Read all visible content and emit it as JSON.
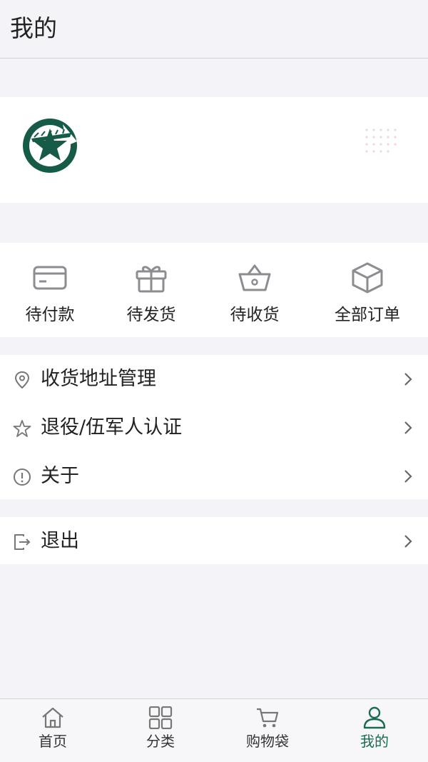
{
  "header": {
    "title": "我的"
  },
  "profile": {
    "avatar_icon": "star-emblem-icon",
    "brand_color": "#155b47"
  },
  "orders": [
    {
      "label": "待付款",
      "icon": "card-icon"
    },
    {
      "label": "待发货",
      "icon": "gift-icon"
    },
    {
      "label": "待收货",
      "icon": "basket-icon"
    },
    {
      "label": "全部订单",
      "icon": "box-icon"
    }
  ],
  "menu": [
    {
      "label": "收货地址管理",
      "icon": "location-pin-icon"
    },
    {
      "label": "退役/伍军人认证",
      "icon": "star-outline-icon"
    },
    {
      "label": "关于",
      "icon": "info-circle-icon"
    }
  ],
  "logout": {
    "label": "退出",
    "icon": "logout-icon"
  },
  "tabbar": {
    "items": [
      {
        "label": "首页",
        "icon": "home-icon"
      },
      {
        "label": "分类",
        "icon": "grid-icon"
      },
      {
        "label": "购物袋",
        "icon": "cart-icon"
      },
      {
        "label": "我的",
        "icon": "user-icon"
      }
    ],
    "active_color": "#1a6b52"
  }
}
